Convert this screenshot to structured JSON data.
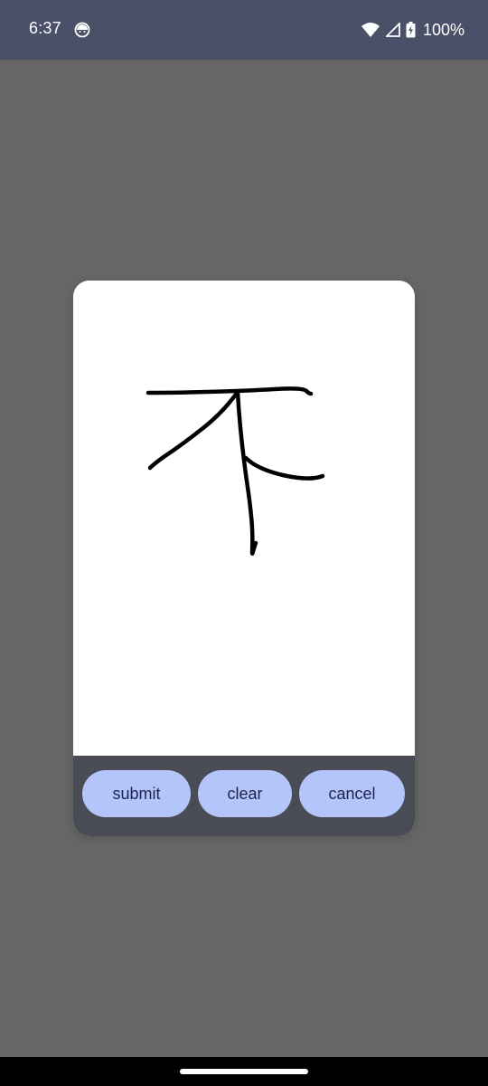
{
  "status_bar": {
    "time": "6:37",
    "app_icon": "android-head-icon",
    "wifi_icon": "wifi-icon",
    "signal_icon": "cell-signal-icon",
    "battery_icon": "battery-charging-icon",
    "battery_level": "100%"
  },
  "dialog": {
    "canvas_content": "handwritten-stroke-drawing",
    "buttons": {
      "submit": "submit",
      "clear": "clear",
      "cancel": "cancel"
    }
  },
  "colors": {
    "status_bar_bg": "#4a5068",
    "scrim": "#666666",
    "button_bar_bg": "#4a4c55",
    "button_bg": "#b4c5fa",
    "button_text": "#1b2550",
    "stroke": "#000000"
  },
  "nav_bar": {
    "handle_icon": "gesture-handle-icon"
  }
}
